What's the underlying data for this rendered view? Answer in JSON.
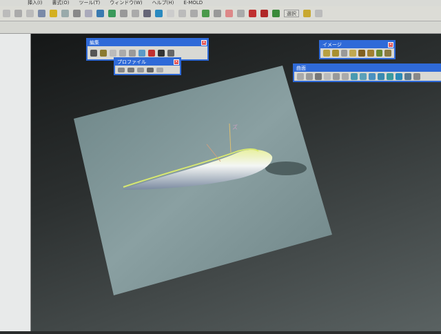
{
  "menubar": {
    "items": [
      "挿入(I)",
      "書式(O)",
      "ツール(T)",
      "ウィンドウ(W)",
      "ヘルプ(H)",
      "E-MOLD"
    ]
  },
  "toolbar": {
    "select_dropdown": "選択"
  },
  "palettes": {
    "edit": {
      "title": "編集"
    },
    "profile": {
      "title": "プロファイル"
    },
    "image": {
      "title": "イメージ"
    },
    "surface": {
      "title": "曲面"
    }
  },
  "viewport": {
    "axis_label": "ズ"
  },
  "colors": {
    "palette_title": "#2f6ad8",
    "plane": "#7d9598",
    "model_highlight": "#d8e870"
  }
}
